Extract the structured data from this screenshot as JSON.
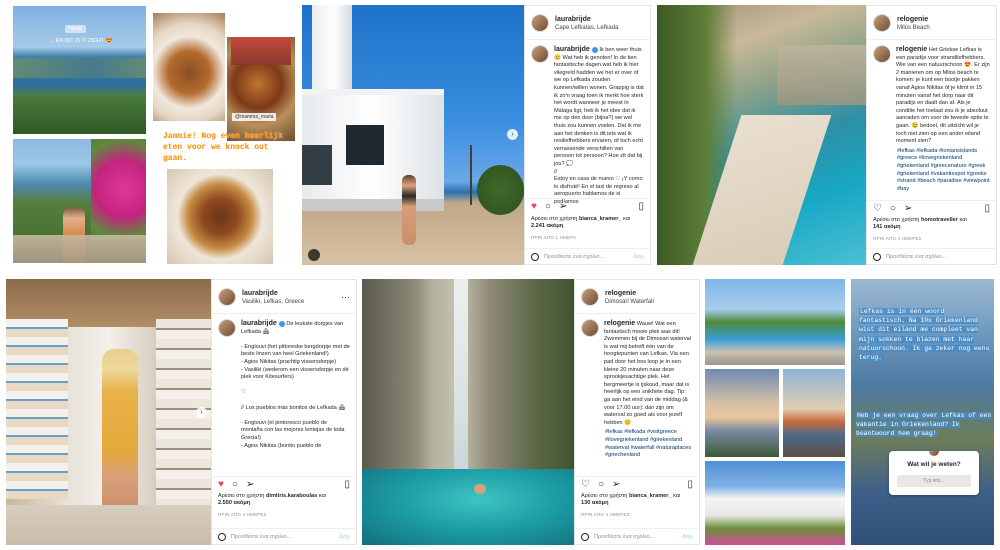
{
  "story1": {
    "tag": "Nuria",
    "text": "... EN DIT IS IT ZICHT 😍"
  },
  "story_food": {
    "overlay_tag": "@mamma_maria",
    "text": "Jammie! Nog even heerlijk eten voor we knock out gaan."
  },
  "post1": {
    "username": "laurabrijde",
    "location": "Cape Lefkatas, Lefkada",
    "caption_user": "laurabrijde",
    "caption": "Ik ben weer thuis 😊 Wat heb ik genoten! In de tien fantastische dagen wat heb ik hier vliegreld hadden we het er over of we op Lefkada zouden kunnen/willen wonen. Grappig is dat ik zo'n vraag toen ik merkt hoe sterk het wordt wanneer je meest in Málaga ligt, heb ik het idee dat ik me op den door (bijna?) we wel thuis zou kunnen voelen. Dat ik me aan het denken is dit iets wat ik resiliefhebbers ervaren, of toch echt verrassende verschillen van persoon tot persoon? Hoe zit dat bij jou? 💭\n//\nEstoy en casa de nuevo ♡ ¡Y como lo disfruté! En el taxi de regreso al aeropuerto hablamos de si podíamos",
    "likes_prefix": "Αρέσει στο χρήστη",
    "likes_user": "bianca_kramer_",
    "likes_suffix": "και",
    "likes_count": "2.241 ακόμη",
    "time": "ΠΡΙΝ ΑΠΟ 1 ΗΜΕΡΑ",
    "comment_placeholder": "Προσθέστε ένα σχόλιο...",
    "post_label": "Δημ"
  },
  "post2": {
    "username": "relogenie",
    "location": "Milos Beach",
    "caption_user": "relogenie",
    "caption": "Het Griekse Lefkas is een paradijs voor strandliefhebbers. Wie van een natuurschoon 😍. Er zijn 2 manieren om op Milos beach te komen: je kunt een bootje pakken vanaf Agios Nikitas óf je klimt in 15 minuten vanaf het dorp naar dit paradijs en daalt dan af. Als je conditie het toelaat zou ik je absoluut aanraden om voor de tweede optie te gaan. 😉 bedoel, dit uitzicht wil je toch niet zien op een ander eiland moment zien?",
    "hashtags": "#lefkas #lefkada #ioniansislands #greece #ilovegriekenland #griekenland #greecenature #greek #griekenland #vakantiespot #greeks #strand #beach #paradise #viewpoint #bay",
    "likes_prefix": "Αρέσει στο χρήστη",
    "likes_user": "homotraveller",
    "likes_suffix": "και",
    "likes_count": "141 ακόμη",
    "time": "ΠΡΙΝ ΑΠΟ 4 ΗΜΕΡΕΣ",
    "comment_placeholder": "Προσθέστε ένα σχόλιο..."
  },
  "post3": {
    "username": "laurabrijde",
    "location": "Vasiliki, Lefkas, Greece",
    "caption_user": "laurabrijde",
    "caption": "De leukste dorpjes van Lefkada 🏘\n\n- Englouvi (het pittoreske bergdorpje met de beste linzen van heel Griekenland!)\n- Agios Nikitas (prachtig vissersdorpje)\n- Vasiliki (wederom een vissersdorpje en dé plek voor Kitesurfers)\n\n♡\n\n// Los pueblos más bonitos de Lefkada 🏘\n\n- Englouvi (el pintoresco pueblo de montaña con las mejores lentejas de toda Grecia!)\n- Agios Nikitas (bonito pueblo de",
    "likes_prefix": "Αρέσει στο χρήστη",
    "likes_user": "dimitris.karaboulas",
    "likes_suffix": "και",
    "likes_count": "2.550 ακόμη",
    "time": "ΠΡΙΝ ΑΠΟ 4 ΗΜΕΡΕΣ",
    "comment_placeholder": "Προσθέστε ένα σχόλιο...",
    "post_label": "Δημ"
  },
  "post4": {
    "username": "relogenie",
    "location": "Dimosari Waterfall",
    "caption_user": "relogenie",
    "caption": "Wauw! Wat een fantastisch mooie plek was dit! Zwemmen bij de Dimosari waterval is wat mij betreft één van de hoogtepunten van Lefkas. Via een pad door het bos loop je in een kleine 20 minuten naar deze sprookjesachtige plek. Het bergmeertje is ijskoud, maar dat is heerlijk op een snikhete dag. Tip: ga aan het eind van de middag (& voor 17.00 uur): dan zijn om waterval zo goed als voor jezelf hebben 😊",
    "hashtags": "#lefkas #lefkada #visitgreece #ilovegriekenland #griekenland #waterval #waterfall #naturaplaces #griechenland",
    "likes_prefix": "Αρέσει στο χρήστη",
    "likes_user": "bianca_kramer_",
    "likes_suffix": "και",
    "likes_count": "130 ακόμη",
    "time": "ΠΡΙΝ ΑΠΟ 4 ΗΜΕΡΕΣ",
    "comment_placeholder": "Προσθέστε ένα σχόλιο...",
    "post_label": "Δημ"
  },
  "story_final": {
    "text1": "Lefkas is in één woord fantastisch. Na 10x Griekenland wist dit eiland me compleet van mijn sokken te blazen met haar natuurschoon. Ik ga zeker nog eens terug.",
    "text2": "Heb je een vraag over Lefkas of een vakantie in Griekenland? Ik beantwoord hem graag!",
    "question_title": "Wat wil je weten?",
    "question_placeholder": "Typ iets..."
  },
  "colors": {
    "accent_blue": "#3897f0",
    "like_red": "#ed4956",
    "story_orange": "#ff8a00",
    "hashtag": "#00376b"
  }
}
